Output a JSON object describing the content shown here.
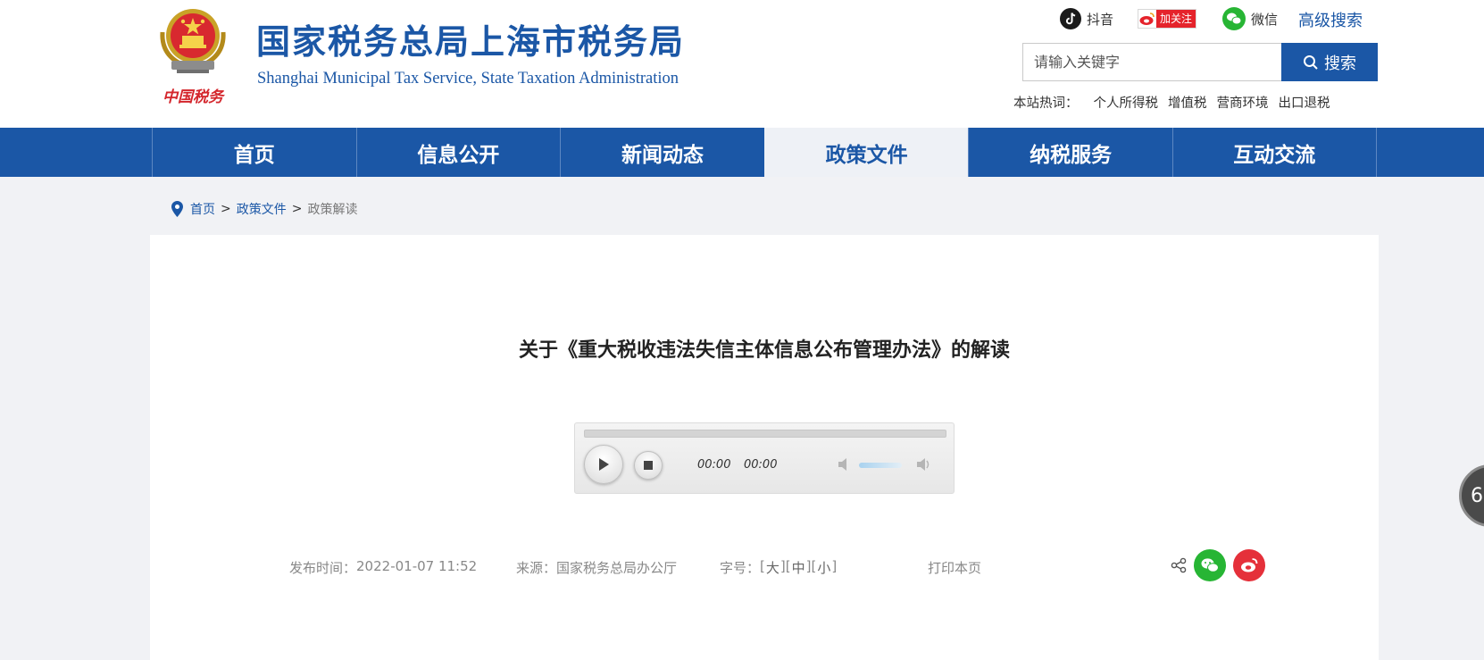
{
  "header": {
    "site_title": "国家税务总局上海市税务局",
    "site_subtitle": "Shanghai Municipal Tax Service, State Taxation Administration",
    "logo_caption": "中国税务",
    "social": {
      "douyin_label": "抖音",
      "weibo_label": "加关注",
      "wechat_label": "微信"
    },
    "advanced_search": "高级搜索",
    "search": {
      "placeholder": "请输入关键字",
      "button_label": "搜索"
    },
    "hot_words": {
      "label": "本站热词：",
      "items": [
        "个人所得税",
        "增值税",
        "营商环境",
        "出口退税"
      ]
    }
  },
  "nav": {
    "items": [
      {
        "label": "首页"
      },
      {
        "label": "信息公开"
      },
      {
        "label": "新闻动态"
      },
      {
        "label": "政策文件"
      },
      {
        "label": "纳税服务"
      },
      {
        "label": "互动交流"
      }
    ],
    "active": "政策文件"
  },
  "breadcrumb": {
    "items": [
      "首页",
      "政策文件",
      "政策解读"
    ],
    "separator": ">"
  },
  "article": {
    "title": "关于《重大税收违法失信主体信息公布管理办法》的解读",
    "audio": {
      "current_time": "00:00",
      "duration": "00:00"
    },
    "meta": {
      "date_label": "发布时间：",
      "date_value": "2022-01-07 11:52",
      "source_label": "来源：",
      "source_value": "国家税务总局办公厅",
      "fontsize_label": "字号：",
      "fontsize_large": "大",
      "fontsize_medium": "中",
      "fontsize_small": "小",
      "print_label": "打印本页"
    }
  },
  "float_widget": {
    "label": "6"
  },
  "colors": {
    "brand_blue": "#1b57a6",
    "wechat_green": "#27b534",
    "weibo_red": "#e5303a"
  }
}
